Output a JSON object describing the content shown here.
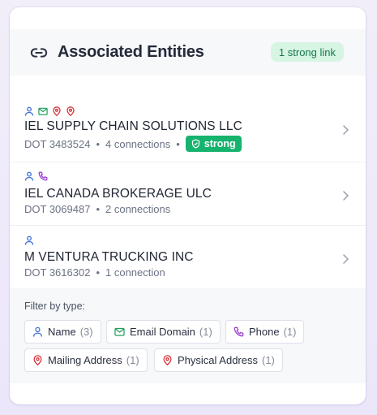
{
  "header": {
    "title": "Associated Entities",
    "icon": "link-icon",
    "badge": "1 strong link"
  },
  "entities": [
    {
      "type_icons": [
        "person-icon",
        "mail-icon",
        "map-pin-icon",
        "map-pin-icon"
      ],
      "name": "IEL SUPPLY CHAIN SOLUTIONS LLC",
      "dot": "DOT 3483524",
      "connections": "4 connections",
      "badge": "strong"
    },
    {
      "type_icons": [
        "person-icon",
        "phone-icon"
      ],
      "name": "IEL CANADA BROKERAGE ULC",
      "dot": "DOT 3069487",
      "connections": "2 connections"
    },
    {
      "type_icons": [
        "person-icon"
      ],
      "name": "M VENTURA TRUCKING INC",
      "dot": "DOT 3616302",
      "connections": "1 connection"
    }
  ],
  "filter": {
    "label": "Filter by type:",
    "chips": [
      {
        "icon": "person-icon",
        "label": "Name",
        "count": "(3)"
      },
      {
        "icon": "mail-icon",
        "label": "Email Domain",
        "count": "(1)"
      },
      {
        "icon": "phone-icon",
        "label": "Phone",
        "count": "(1)"
      },
      {
        "icon": "map-pin-icon",
        "label": "Mailing Address",
        "count": "(1)"
      },
      {
        "icon": "map-pin-icon",
        "label": "Physical Address",
        "count": "(1)"
      }
    ]
  },
  "colors": {
    "person": "#3b6fd8",
    "mail": "#1f9d5a",
    "pin": "#d6333c",
    "phone": "#9b3fd1",
    "strong": "#16b36e"
  }
}
